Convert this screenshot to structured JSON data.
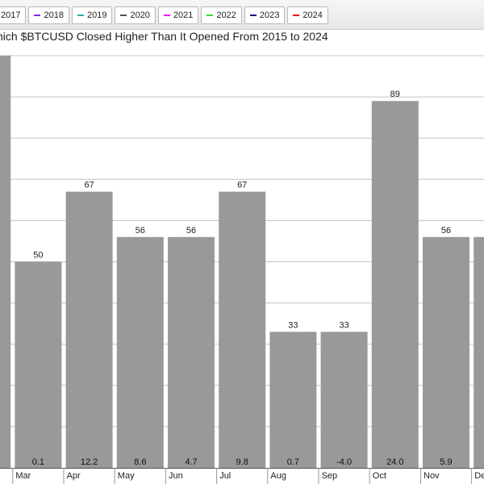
{
  "legend": [
    {
      "label": "2017",
      "color": "#ff8c00"
    },
    {
      "label": "2018",
      "color": "#8a2be2"
    },
    {
      "label": "2019",
      "color": "#20b2aa"
    },
    {
      "label": "2020",
      "color": "#555555"
    },
    {
      "label": "2021",
      "color": "#ff00ff"
    },
    {
      "label": "2022",
      "color": "#33dd33"
    },
    {
      "label": "2023",
      "color": "#00008b"
    },
    {
      "label": "2024",
      "color": "#ff0000"
    }
  ],
  "chart_data": {
    "type": "bar",
    "title": "hich $BTCUSD Closed Higher Than It Opened From 2015 to 2024",
    "categories": [
      "",
      "Mar",
      "Apr",
      "May",
      "Jun",
      "Jul",
      "Aug",
      "Sep",
      "Oct",
      "Nov",
      "De"
    ],
    "values": [
      100,
      50,
      67,
      56,
      56,
      67,
      33,
      33,
      89,
      56,
      56
    ],
    "value_labels": [
      "",
      "50",
      "67",
      "56",
      "56",
      "67",
      "33",
      "33",
      "89",
      "56",
      ""
    ],
    "inner_labels": [
      "",
      "0.1",
      "12.2",
      "8.6",
      "4.7",
      "9.8",
      "0.7",
      "-4.0",
      "24.0",
      "5.9",
      ""
    ],
    "ylim": [
      0,
      100
    ],
    "grid": true,
    "bar_color": "#999999"
  }
}
